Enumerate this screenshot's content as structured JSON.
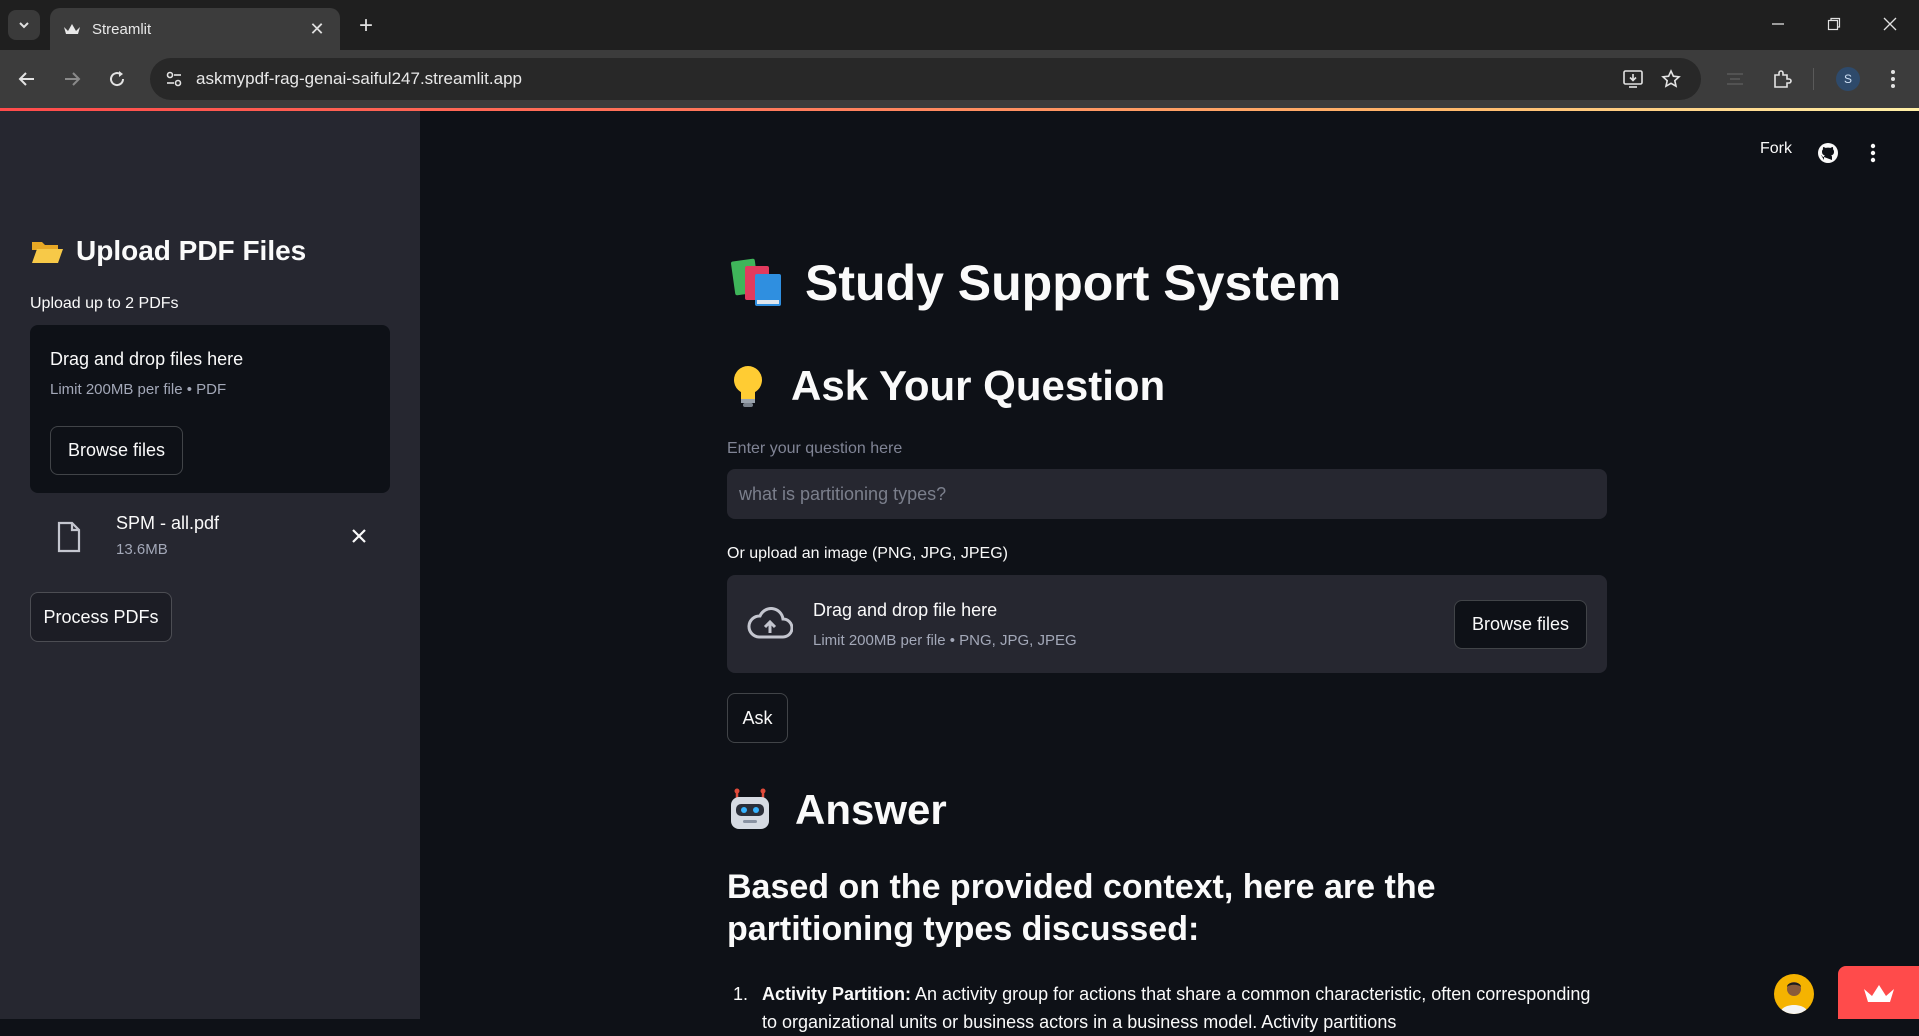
{
  "browser": {
    "tab_title": "Streamlit",
    "tab_close": "✕",
    "new_tab": "+",
    "url": "askmypdf-rag-genai-saiful247.streamlit.app",
    "profile_initial": "S",
    "accent_color": "#ff4b4b"
  },
  "app_header": {
    "fork_label": "Fork"
  },
  "sidebar": {
    "title": "Upload PDF Files",
    "upload_label": "Upload up to 2 PDFs",
    "dropzone_title": "Drag and drop files here",
    "dropzone_limit": "Limit 200MB per file • PDF",
    "browse_label": "Browse files",
    "file": {
      "name": "SPM - all.pdf",
      "size": "13.6MB"
    },
    "process_label": "Process PDFs"
  },
  "main": {
    "title": "Study Support System",
    "ask_heading": "Ask Your Question",
    "question_label": "Enter your question here",
    "question_placeholder": "what is partitioning types?",
    "image_label": "Or upload an image (PNG, JPG, JPEG)",
    "image_drop_title": "Drag and drop file here",
    "image_drop_limit": "Limit 200MB per file • PNG, JPG, JPEG",
    "image_browse_label": "Browse files",
    "ask_label": "Ask",
    "answer_heading": "Answer",
    "answer_intro": "Based on the provided context, here are the partitioning types discussed:",
    "answer_items": [
      {
        "number": "1.",
        "term": "Activity Partition:",
        "text": " An activity group for actions that share a common characteristic, often corresponding to organizational units or business actors in a business model. Activity partitions"
      }
    ]
  }
}
